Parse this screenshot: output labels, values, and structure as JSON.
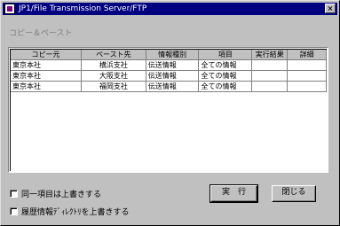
{
  "window": {
    "title": "JP1/File Transmission Server/FTP",
    "close_glyph": "×",
    "icon": "jp1-app-icon"
  },
  "section": {
    "label": "コピー＆ペースト"
  },
  "grid": {
    "columns": [
      "コピー元",
      "ペースト先",
      "情報種別",
      "項目",
      "実行結果",
      "詳細"
    ],
    "rows": [
      [
        "東京本社",
        "横浜支社",
        "伝送情報",
        "全ての情報",
        "",
        ""
      ],
      [
        "東京本社",
        "大阪支社",
        "伝送情報",
        "全ての情報",
        "",
        ""
      ],
      [
        "東京本社",
        "福岡支社",
        "伝送情報",
        "全ての情報",
        "",
        ""
      ]
    ]
  },
  "options": {
    "overwrite_same_item": "同一項目は上書きする",
    "overwrite_history_dir": "履歴情報ﾃﾞｨﾚｸﾄﾘを上書きする"
  },
  "buttons": {
    "execute": "実　行",
    "close": "閉じる"
  },
  "colors": {
    "titlebar": "#000080",
    "face": "#c0c0c0"
  }
}
